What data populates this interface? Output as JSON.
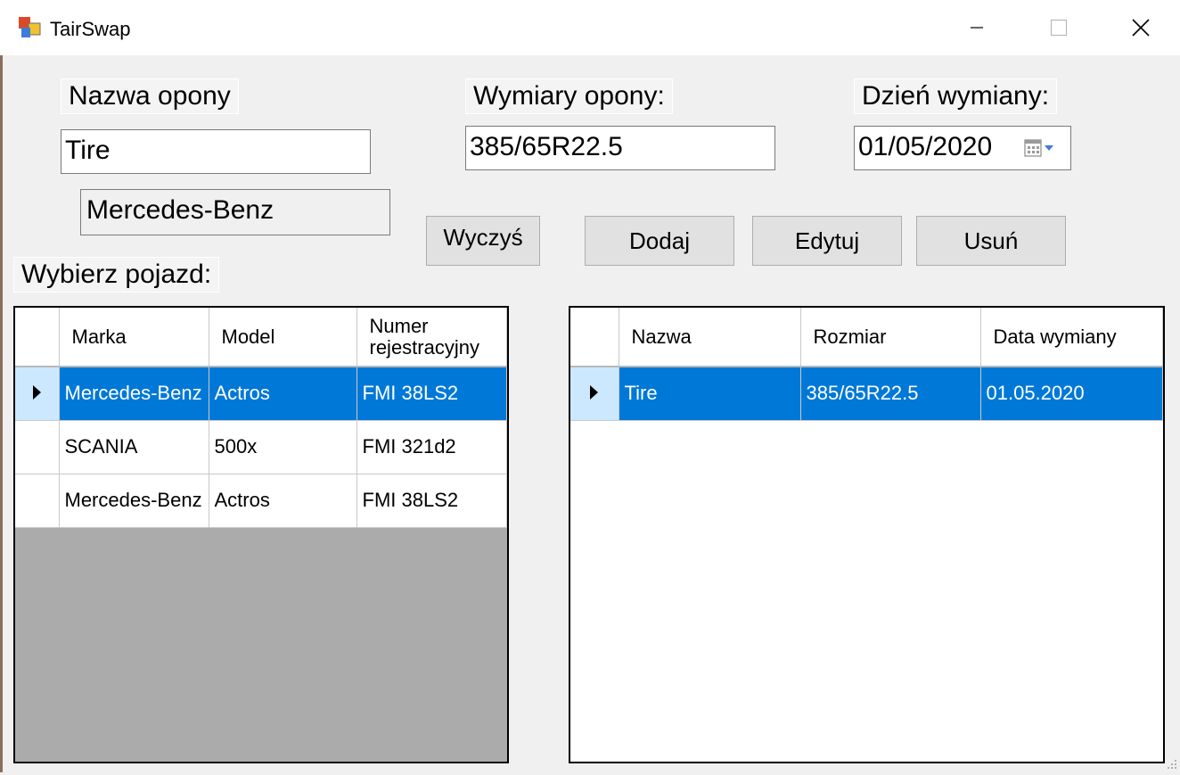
{
  "window": {
    "title": "TairSwap"
  },
  "form": {
    "tire_name_label": "Nazwa opony",
    "tire_name_value": "Tire",
    "vehicle_brand_value": "Mercedes-Benz",
    "select_vehicle_label": "Wybierz pojazd:",
    "tire_size_label": "Wymiary opony:",
    "tire_size_value": "385/65R22.5",
    "change_date_label": "Dzień wymiany:",
    "change_date_value": "01/05/2020",
    "clear_button": "Wyczyś",
    "add_button": "Dodaj",
    "edit_button": "Edytuj",
    "delete_button": "Usuń"
  },
  "vehicles_grid": {
    "columns": [
      "Marka",
      "Model",
      "Numer rejestracyjny"
    ],
    "rows": [
      [
        "Mercedes-Benz",
        "Actros",
        "FMI 38LS2"
      ],
      [
        "SCANIA",
        "500x",
        "FMI 321d2"
      ],
      [
        "Mercedes-Benz",
        "Actros",
        "FMI 38LS2"
      ]
    ],
    "selected_row": 0
  },
  "tires_grid": {
    "columns": [
      "Nazwa",
      "Rozmiar",
      "Data wymiany"
    ],
    "rows": [
      [
        "Tire",
        "385/65R22.5",
        "01.05.2020"
      ]
    ],
    "selected_row": 0
  },
  "icons": {
    "app": "app-icon",
    "calendar": "calendar-dropdown-icon",
    "row_pointer": "row-pointer-icon"
  },
  "colors": {
    "selection": "#0078d7",
    "grid_empty": "#ababab"
  }
}
